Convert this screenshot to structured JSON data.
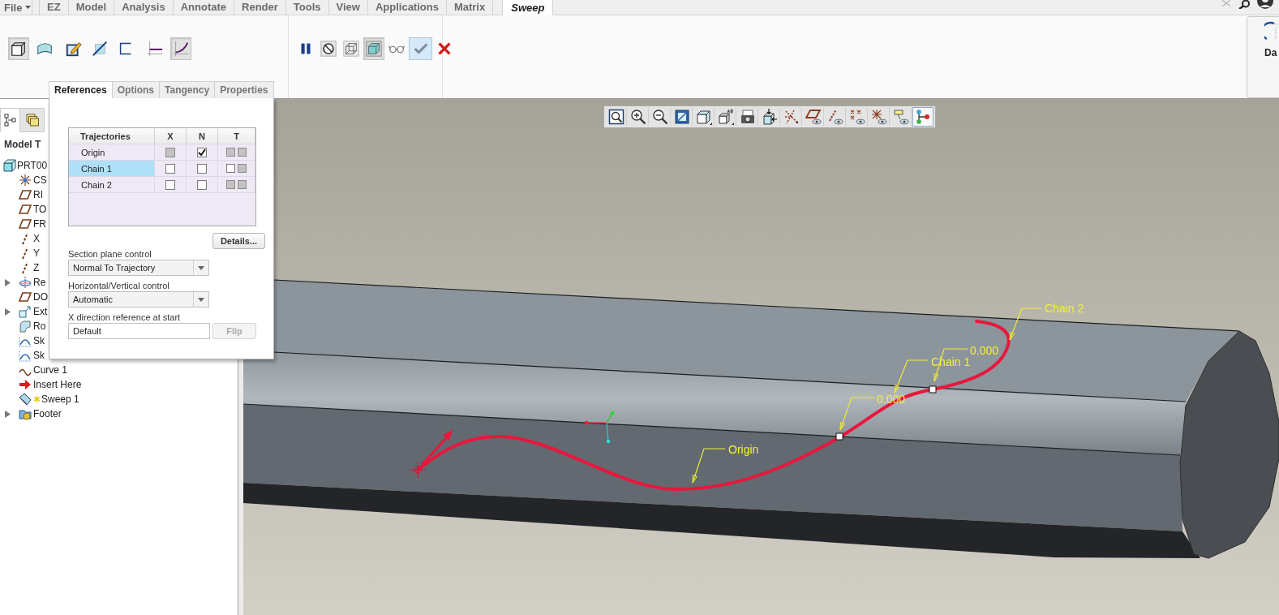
{
  "menu": {
    "file": "File",
    "tabs": [
      {
        "label": "EZ",
        "kind": "standard",
        "selected": false
      },
      {
        "label": "Model",
        "kind": "standard",
        "selected": false
      },
      {
        "label": "Analysis",
        "kind": "standard",
        "selected": false
      },
      {
        "label": "Annotate",
        "kind": "standard",
        "selected": false
      },
      {
        "label": "Render",
        "kind": "standard",
        "selected": false
      },
      {
        "label": "Tools",
        "kind": "standard",
        "selected": false
      },
      {
        "label": "View",
        "kind": "standard",
        "selected": false
      },
      {
        "label": "Applications",
        "kind": "standard",
        "selected": false
      },
      {
        "label": "Matrix",
        "kind": "standard",
        "selected": false
      },
      {
        "label": "Sweep",
        "kind": "contextual",
        "selected": true
      }
    ]
  },
  "ribbon": {
    "groups": [
      {
        "sets": [
          [
            {
              "kind": "solid",
              "selected": true
            },
            {
              "kind": "surface",
              "selected": false
            }
          ],
          [
            {
              "kind": "sketch",
              "selected": false
            },
            {
              "kind": "section",
              "selected": false
            },
            {
              "kind": "open-section",
              "selected": false
            }
          ],
          [
            {
              "kind": "constant-section",
              "selected": false
            },
            {
              "kind": "variable-section",
              "selected": true
            }
          ]
        ]
      },
      {
        "sets": [
          [
            {
              "kind": "pause",
              "selected": false
            },
            {
              "kind": "no-preview",
              "selected": false
            },
            {
              "kind": "preview",
              "selected": false
            },
            {
              "kind": "verify",
              "selected": true
            },
            {
              "kind": "glasses",
              "selected": false
            },
            {
              "kind": "confirm",
              "selected": false
            },
            {
              "kind": "cancel",
              "selected": false
            }
          ]
        ]
      }
    ],
    "side_button": {
      "label": "Da"
    }
  },
  "dashboard_tabs": [
    {
      "label": "References",
      "selected": true
    },
    {
      "label": "Options",
      "selected": false
    },
    {
      "label": "Tangency",
      "selected": false
    },
    {
      "label": "Properties",
      "selected": false
    }
  ],
  "references_panel": {
    "table": {
      "columns": [
        "Trajectories",
        "X",
        "N",
        "T"
      ],
      "rows": [
        {
          "name": "Origin",
          "selected": false,
          "x": {
            "checked": false,
            "disabled": true
          },
          "n": {
            "checked": true,
            "disabled": false
          },
          "t": [
            {
              "checked": false,
              "disabled": true
            },
            {
              "checked": false,
              "disabled": true
            }
          ]
        },
        {
          "name": "Chain 1",
          "selected": true,
          "x": {
            "checked": false,
            "disabled": false
          },
          "n": {
            "checked": false,
            "disabled": false
          },
          "t": [
            {
              "checked": false,
              "disabled": false
            },
            {
              "checked": false,
              "disabled": true
            }
          ]
        },
        {
          "name": "Chain 2",
          "selected": false,
          "x": {
            "checked": false,
            "disabled": false
          },
          "n": {
            "checked": false,
            "disabled": false
          },
          "t": [
            {
              "checked": false,
              "disabled": true
            },
            {
              "checked": false,
              "disabled": true
            }
          ]
        }
      ]
    },
    "details_button": "Details...",
    "fields": [
      {
        "kind": "dropdown",
        "label": "Section plane control",
        "value": "Normal To Trajectory"
      },
      {
        "kind": "dropdown",
        "label": "Horizontal/Vertical control",
        "value": "Automatic"
      },
      {
        "kind": "text",
        "label": "X direction reference at start",
        "value": "Default",
        "button": {
          "label": "Flip",
          "disabled": true
        }
      }
    ]
  },
  "model_tree": {
    "tabs": [
      {
        "kind": "tree",
        "selected": true
      },
      {
        "kind": "layers",
        "selected": false
      }
    ],
    "header": "Model T",
    "items": [
      {
        "label": "PRT00",
        "kind": "part",
        "new": false,
        "children": [
          {
            "label": "CS",
            "kind": "csys",
            "new": false
          },
          {
            "label": "RI",
            "kind": "plane",
            "new": false
          },
          {
            "label": "TO",
            "kind": "plane",
            "new": false
          },
          {
            "label": "FR",
            "kind": "plane",
            "new": false
          },
          {
            "label": "X",
            "kind": "axis",
            "new": false
          },
          {
            "label": "Y",
            "kind": "axis",
            "new": false
          },
          {
            "label": "Z",
            "kind": "axis",
            "new": false
          },
          {
            "label": "Re",
            "kind": "revolve",
            "expanded": false,
            "new": false
          },
          {
            "label": "DO",
            "kind": "plane",
            "new": false
          },
          {
            "label": "Ext",
            "kind": "extrude",
            "expanded": false,
            "new": false
          },
          {
            "label": "Ro",
            "kind": "round",
            "new": false
          },
          {
            "label": "Sk",
            "kind": "sketch",
            "new": false
          },
          {
            "label": "Sk",
            "kind": "sketch",
            "new": false
          },
          {
            "label": "Curve 1",
            "kind": "curve",
            "new": false
          },
          {
            "label": "Insert Here",
            "kind": "insert",
            "new": false
          },
          {
            "label": "Sweep 1",
            "kind": "sweep",
            "new": true
          },
          {
            "label": "Footer",
            "kind": "footer",
            "expanded": false,
            "new": false
          }
        ]
      }
    ]
  },
  "viewport": {
    "toolbar": [
      {
        "kind": "zoom-fit",
        "selected": false
      },
      {
        "kind": "zoom-in",
        "selected": false
      },
      {
        "kind": "zoom-out",
        "selected": false
      },
      {
        "kind": "repaint",
        "selected": false
      },
      {
        "kind": "display-style",
        "selected": false
      },
      {
        "kind": "saved-views",
        "selected": false
      },
      {
        "kind": "view-manager",
        "selected": false
      },
      {
        "kind": "perspective",
        "selected": false
      },
      {
        "kind": "datum-display",
        "selected": false
      },
      {
        "kind": "plane-display",
        "selected": false
      },
      {
        "kind": "axis-display",
        "selected": false
      },
      {
        "kind": "point-display",
        "selected": false
      },
      {
        "kind": "csys-display",
        "selected": false
      },
      {
        "kind": "annotation-display",
        "selected": false
      },
      {
        "kind": "spin-center",
        "selected": true
      }
    ],
    "annotations": [
      "Chain 2",
      "0.000",
      "Chain 1",
      "0.000",
      "Origin"
    ]
  }
}
